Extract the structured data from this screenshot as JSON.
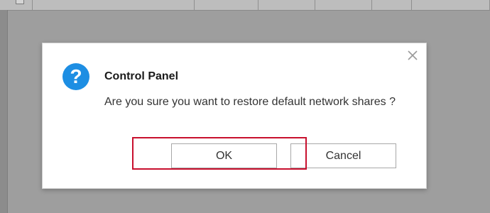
{
  "dialog": {
    "title": "Control Panel",
    "message": "Are you sure you want to restore default network shares ?",
    "ok_label": "OK",
    "cancel_label": "Cancel"
  },
  "icons": {
    "dialog_icon": "question-icon",
    "close": "close-icon"
  },
  "colors": {
    "accent": "#1d8ee3",
    "highlight": "#c8102e",
    "overlay": "#9e9e9e"
  }
}
